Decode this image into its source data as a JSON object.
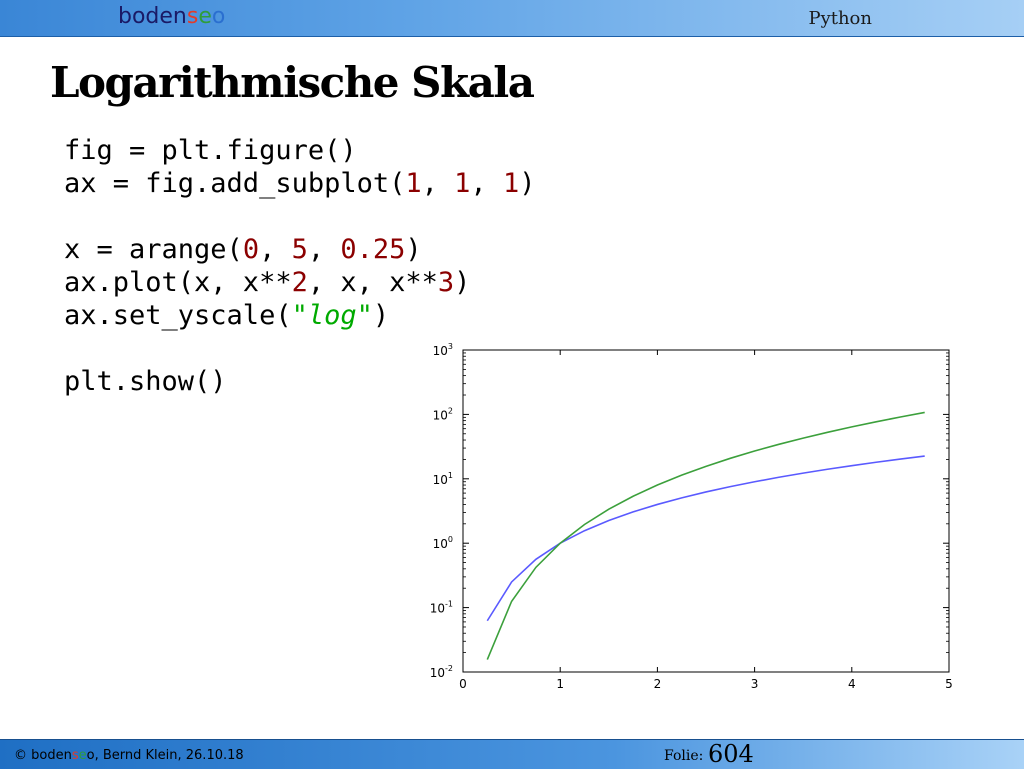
{
  "header": {
    "logo_part1": "boden",
    "logo_part2": "s",
    "logo_part3": "e",
    "logo_part4": "o",
    "right_label": "Python"
  },
  "slide": {
    "title": "Logarithmische Skala"
  },
  "code": {
    "line1": "fig = plt.figure()",
    "line2_a": "ax = fig.add_subplot(",
    "line2_n1": "1",
    "line2_sep1": ", ",
    "line2_n2": "1",
    "line2_sep2": ", ",
    "line2_n3": "1",
    "line2_b": ")",
    "line4_a": "x = arange(",
    "line4_n1": "0",
    "line4_sep1": ", ",
    "line4_n2": "5",
    "line4_sep2": ", ",
    "line4_n3": "0.25",
    "line4_b": ")",
    "line5_a": "ax.plot(x, x**",
    "line5_n1": "2",
    "line5_mid": ", x, x**",
    "line5_n2": "3",
    "line5_b": ")",
    "line6_a": "ax.set_yscale(",
    "line6_q1": "\"",
    "line6_str": "log",
    "line6_q2": "\"",
    "line6_b": ")",
    "line8": "plt.show()"
  },
  "footer": {
    "copyright": "© ",
    "brand1": "boden",
    "brand2": "s",
    "brand3": "e",
    "brand4": "o",
    "author": ", Bernd Klein, 26.10.18",
    "folie_label": "Folie:",
    "folie_number": "604"
  },
  "chart_data": {
    "type": "line",
    "title": "",
    "xlabel": "",
    "ylabel": "",
    "yscale": "log",
    "xlim": [
      0,
      5
    ],
    "ylim": [
      0.01,
      1000
    ],
    "x_ticks": [
      "0",
      "1",
      "2",
      "3",
      "4",
      "5"
    ],
    "y_ticks": [
      {
        "base": "10",
        "exp": "-2"
      },
      {
        "base": "10",
        "exp": "-1"
      },
      {
        "base": "10",
        "exp": "0"
      },
      {
        "base": "10",
        "exp": "1"
      },
      {
        "base": "10",
        "exp": "2"
      },
      {
        "base": "10",
        "exp": "3"
      }
    ],
    "x": [
      0.25,
      0.5,
      0.75,
      1.0,
      1.25,
      1.5,
      1.75,
      2.0,
      2.25,
      2.5,
      2.75,
      3.0,
      3.25,
      3.5,
      3.75,
      4.0,
      4.25,
      4.5,
      4.75
    ],
    "series": [
      {
        "color": "#5a5aff",
        "values": [
          0.0625,
          0.25,
          0.5625,
          1.0,
          1.5625,
          2.25,
          3.0625,
          4.0,
          5.0625,
          6.25,
          7.5625,
          9.0,
          10.5625,
          12.25,
          14.0625,
          16.0,
          18.0625,
          20.25,
          22.5625
        ]
      },
      {
        "color": "#3ca03c",
        "values": [
          0.015625,
          0.125,
          0.421875,
          1.0,
          1.953125,
          3.375,
          5.359375,
          8.0,
          11.390625,
          15.625,
          20.796875,
          27.0,
          34.328125,
          42.875,
          52.734375,
          64.0,
          76.765625,
          91.125,
          107.171875
        ]
      }
    ]
  }
}
